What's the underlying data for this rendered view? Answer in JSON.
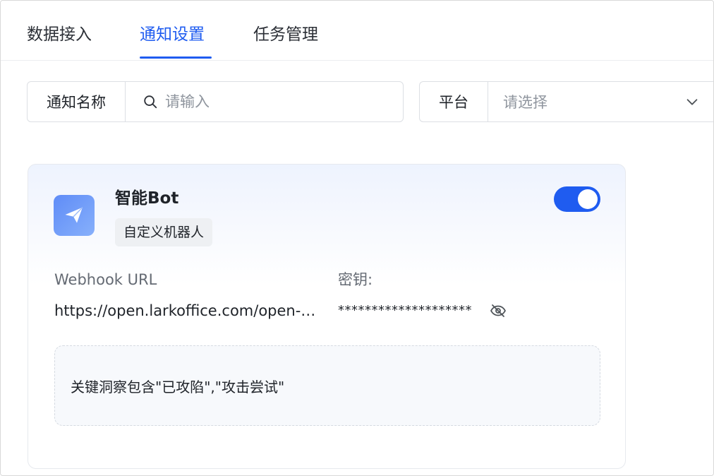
{
  "tabs": [
    {
      "label": "数据接入",
      "active": false
    },
    {
      "label": "通知设置",
      "active": true
    },
    {
      "label": "任务管理",
      "active": false
    }
  ],
  "filters": {
    "name": {
      "label": "通知名称",
      "placeholder": "请输入",
      "icon": "search-icon"
    },
    "platform": {
      "label": "平台",
      "placeholder": "请选择",
      "icon": "chevron-down-icon"
    }
  },
  "card": {
    "title": "智能Bot",
    "tag": "自定义机器人",
    "enabled": true,
    "webhook_label": "Webhook URL",
    "webhook_value": "https://open.larkoffice.com/open-…",
    "secret_label": "密钥:",
    "secret_value": "********************",
    "rule_text": "关键洞察包含\"已攻陷\",\"攻击尝试\""
  },
  "colors": {
    "accent": "#1f5cf0",
    "avatar_gradient_start": "#5f8cf7",
    "avatar_gradient_end": "#87b0fb"
  }
}
